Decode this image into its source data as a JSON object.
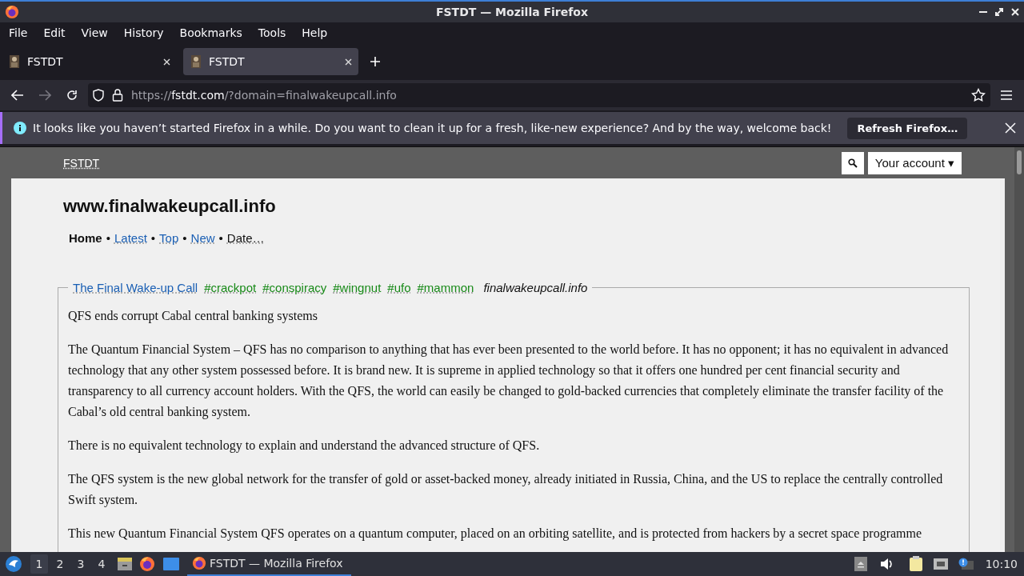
{
  "window": {
    "title": "FSTDT — Mozilla Firefox"
  },
  "menu": [
    "File",
    "Edit",
    "View",
    "History",
    "Bookmarks",
    "Tools",
    "Help"
  ],
  "tabs": [
    {
      "label": "FSTDT",
      "selected": false
    },
    {
      "label": "FSTDT",
      "selected": true
    }
  ],
  "address_bar": {
    "scheme": "https://",
    "host": "fstdt.com",
    "path": "/?domain=finalwakeupcall.info"
  },
  "notification": {
    "message": "It looks like you haven’t started Firefox in a while. Do you want to clean it up for a fresh, like-new experience? And by the way, welcome back!",
    "button": "Refresh Firefox…"
  },
  "site": {
    "logo": "FSTDT",
    "account": "Your account ▾"
  },
  "page": {
    "heading": "www.finalwakeupcall.info",
    "nav_separator": "•",
    "nav": [
      {
        "label": "Home",
        "selected": true,
        "kind": "link"
      },
      {
        "label": "Latest",
        "selected": false,
        "kind": "link"
      },
      {
        "label": "Top",
        "selected": false,
        "kind": "link"
      },
      {
        "label": "New",
        "selected": false,
        "kind": "link"
      },
      {
        "label": "Date…",
        "selected": false,
        "kind": "menu"
      }
    ],
    "post": {
      "tags": [
        {
          "label": "The Final Wake-up Call",
          "kind": "title"
        },
        {
          "label": "#crackpot",
          "kind": "tag"
        },
        {
          "label": "#conspiracy",
          "kind": "tag"
        },
        {
          "label": "#wingnut",
          "kind": "tag"
        },
        {
          "label": "#ufo",
          "kind": "tag"
        },
        {
          "label": "#mammon",
          "kind": "tag"
        },
        {
          "label": "finalwakeupcall.info",
          "kind": "source"
        }
      ],
      "paragraphs": [
        "QFS ends corrupt Cabal central banking systems",
        "The Quantum Financial System – QFS has no comparison to anything that has ever been presented to the world before. It has no opponent; it has no equivalent in advanced technology that any other system possessed before. It is brand new. It is supreme in applied technology so that it offers one hundred per cent financial security and transparency to all currency account holders. With the QFS, the world can easily be changed to gold-backed currencies that completely eliminate the transfer facility of the Cabal’s old central banking system.",
        "There is no equivalent technology to explain and understand the advanced structure of QFS.",
        "The QFS system is the new global network for the transfer of gold or asset-backed money, already initiated in Russia, China, and the US to replace the centrally controlled Swift system.",
        "This new Quantum Financial System QFS operates on a quantum computer, placed on an orbiting satellite, and is protected from hackers by a secret space programme"
      ]
    }
  },
  "taskbar": {
    "workspaces": [
      {
        "label": "1",
        "selected": true
      },
      {
        "label": "2",
        "selected": false
      },
      {
        "label": "3",
        "selected": false
      },
      {
        "label": "4",
        "selected": false
      }
    ],
    "windows": [
      {
        "label": "FSTDT — Mozilla Firefox",
        "selected": true
      }
    ],
    "clock": "10:10"
  }
}
